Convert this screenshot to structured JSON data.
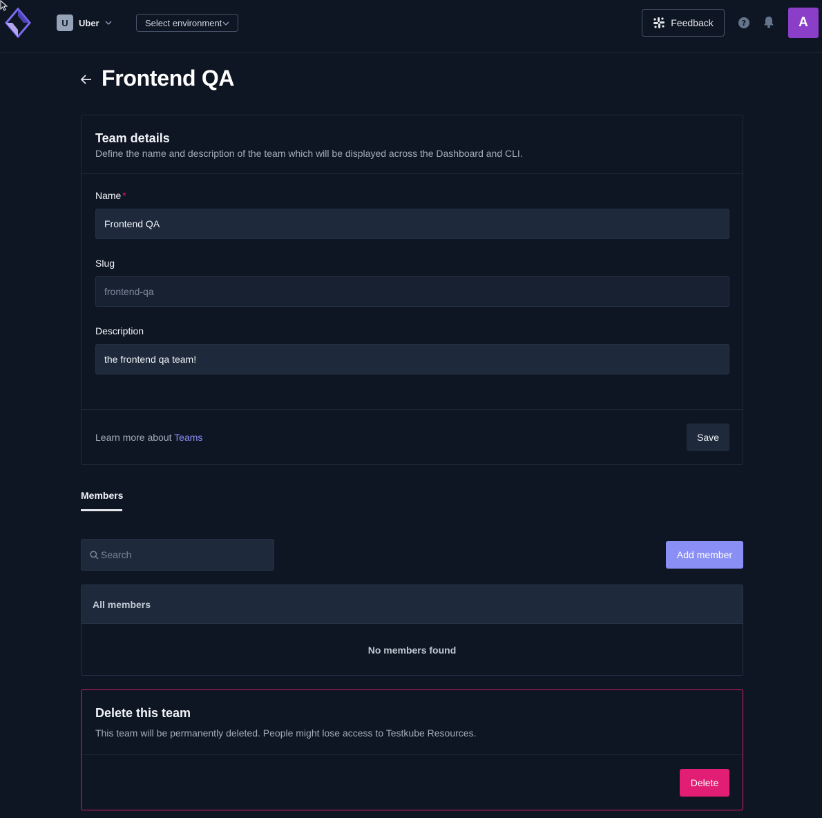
{
  "topbar": {
    "org_initial": "U",
    "org_name": "Uber",
    "environment_placeholder": "Select environment",
    "feedback_label": "Feedback",
    "user_initial": "A"
  },
  "page": {
    "title": "Frontend QA"
  },
  "team_details": {
    "title": "Team details",
    "subtitle": "Define the name and description of the team which will be displayed across the Dashboard and CLI.",
    "name_label": "Name",
    "name_required_mark": "*",
    "name_value": "Frontend QA",
    "slug_label": "Slug",
    "slug_value": "frontend-qa",
    "description_label": "Description",
    "description_value": "the frontend qa team!",
    "learn_more_prefix": "Learn more about ",
    "learn_more_link": "Teams",
    "save_label": "Save"
  },
  "members": {
    "tab_label": "Members",
    "search_placeholder": "Search",
    "add_label": "Add member",
    "table_header": "All members",
    "empty_message": "No members found"
  },
  "danger": {
    "title": "Delete this team",
    "subtitle": "This team will be permanently deleted. People might lose access to Testkube Resources.",
    "delete_label": "Delete"
  },
  "colors": {
    "background": "#0f1623",
    "accent": "#8a8ff5",
    "danger": "#e11d74",
    "user_avatar": "#8b3fc9"
  },
  "icons": [
    "testkube-logo-icon",
    "chevron-down-icon",
    "slack-icon",
    "help-icon",
    "bell-icon",
    "back-arrow-icon",
    "search-icon",
    "cursor-icon"
  ]
}
